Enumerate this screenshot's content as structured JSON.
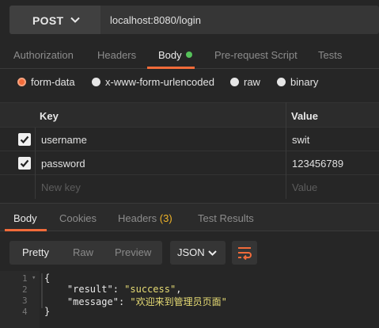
{
  "request": {
    "method": "POST",
    "url": "localhost:8080/login"
  },
  "request_tabs": [
    "Authorization",
    "Headers",
    "Body",
    "Pre-request Script",
    "Tests"
  ],
  "active_request_tab": "Body",
  "body_types": [
    "form-data",
    "x-www-form-urlencoded",
    "raw",
    "binary"
  ],
  "selected_body_type": "form-data",
  "table": {
    "headers": {
      "key": "Key",
      "value": "Value"
    },
    "rows": [
      {
        "checked": true,
        "key": "username",
        "value": "swit"
      },
      {
        "checked": true,
        "key": "password",
        "value": "123456789"
      }
    ],
    "new_row": {
      "key_placeholder": "New key",
      "value_placeholder": "Value"
    }
  },
  "response_tabs": {
    "body": "Body",
    "cookies": "Cookies",
    "headers": "Headers",
    "headers_count": "(3)",
    "test_results": "Test Results"
  },
  "active_response_tab": "Body",
  "view": {
    "modes": [
      "Pretty",
      "Raw",
      "Preview"
    ],
    "active": "Pretty",
    "format": "JSON"
  },
  "code": {
    "line_numbers": [
      "1",
      "2",
      "3",
      "4"
    ],
    "lines": [
      {
        "open": "{"
      },
      {
        "key": "\"result\"",
        "sep": ": ",
        "value": "\"success\"",
        "end": ","
      },
      {
        "key": "\"message\"",
        "sep": ": ",
        "value": "\"欢迎来到管理员页面\"",
        "end": ""
      },
      {
        "open": "}"
      }
    ]
  },
  "icons": {
    "method_dropdown": "chevron-down-icon",
    "format_dropdown": "chevron-down-icon",
    "wrap": "wrap-lines-icon",
    "checkbox": "checkmark-icon"
  },
  "colors": {
    "accent": "#f26b3a",
    "body_dot": "#56c25a",
    "count": "#f0b429",
    "string": "#e6db74"
  }
}
